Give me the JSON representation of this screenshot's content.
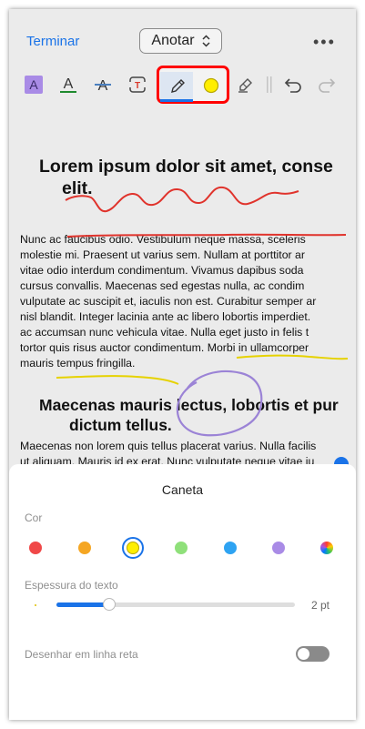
{
  "header": {
    "done_label": "Terminar",
    "mode_label": "Anotar",
    "more_icon": "ellipsis-icon"
  },
  "toolbar": {
    "tools": [
      "highlight-text-icon",
      "underline-text-icon",
      "strikethrough-text-icon",
      "text-box-icon",
      "pen-icon",
      "pen-color-icon",
      "eraser-icon",
      "undo-icon",
      "redo-icon"
    ],
    "active_tool": "pen",
    "active_color": "#ffee00",
    "highlight_color": "#a98be6",
    "underline_color": "#1f8a2e",
    "strike_color": "#4a7fbf",
    "textbox_color": "#d93a2b"
  },
  "document": {
    "heading1_line1": "Lorem ipsum dolor sit amet, conse",
    "heading1_line2": "elit.",
    "paragraph1": [
      "Nunc ac faucibus odio. Vestibulum neque massa, sceleris",
      "molestie mi. Praesent ut varius sem. Nullam at porttitor ar",
      "vitae odio interdum condimentum. Vivamus dapibus soda",
      "cursus convallis. Maecenas sed egestas nulla, ac condim",
      "vulputate ac suscipit et, iaculis non est. Curabitur semper ar",
      "nisl blandit. Integer lacinia ante ac libero lobortis imperdiet.",
      "ac accumsan nunc vehicula vitae. Nulla eget justo in felis t",
      "tortor quis risus auctor condimentum. Morbi in ullamcorper",
      "mauris tempus fringilla."
    ],
    "heading2_line1": "Maecenas mauris lectus, lobortis et pur",
    "heading2_line2": "dictum tellus.",
    "paragraph2": [
      "Maecenas non lorem quis tellus placerat varius. Nulla facilis",
      "ut aliquam. Mauris id ex erat. Nunc vulputate neque vitae ju"
    ],
    "ink_colors": {
      "red": "#e0332c",
      "yellow": "#e6d200",
      "purple": "#9b83d6"
    }
  },
  "pen_panel": {
    "title": "Caneta",
    "color_label": "Cor",
    "colors": [
      "#f04848",
      "#f5a623",
      "#ffee00",
      "#8fe07a",
      "#2ea3f2",
      "#a98be6",
      "multicolor"
    ],
    "selected_color_index": 2,
    "thickness_label": "Espessura do texto",
    "thickness_value": "2 pt",
    "thickness_fraction": 0.22,
    "straight_line_label": "Desenhar em linha reta",
    "straight_line_on": false
  }
}
